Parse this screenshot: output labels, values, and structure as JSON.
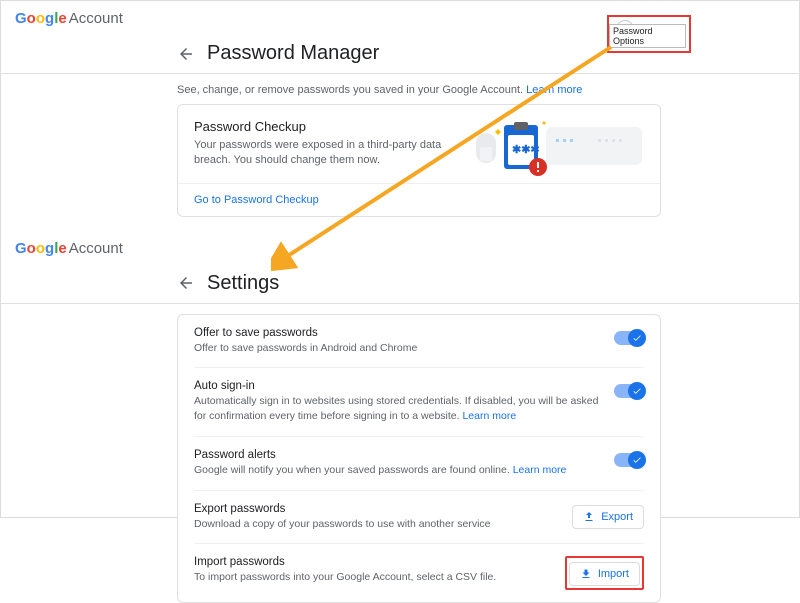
{
  "brand": {
    "g": "G",
    "o1": "o",
    "o2": "o",
    "g2": "g",
    "l": "l",
    "e": "e",
    "account_label": "Account"
  },
  "pm": {
    "title": "Password Manager",
    "subtext": "See, change, or remove passwords you saved in your Google Account.",
    "learn": "Learn more",
    "card_title": "Password Checkup",
    "card_desc": "Your passwords were exposed in a third-party data breach. You should change them now.",
    "card_link": "Go to Password Checkup"
  },
  "gear": {
    "tooltip": "Password Options"
  },
  "settings": {
    "title": "Settings",
    "rows": [
      {
        "title": "Offer to save passwords",
        "desc": "Offer to save passwords in Android and Chrome",
        "kind": "toggle"
      },
      {
        "title": "Auto sign-in",
        "desc": "Automatically sign in to websites using stored credentials. If disabled, you will be asked for confirmation every time before signing in to a website.",
        "learn": "Learn more",
        "kind": "toggle"
      },
      {
        "title": "Password alerts",
        "desc": "Google will notify you when your saved passwords are found online.",
        "learn": "Learn more",
        "kind": "toggle"
      },
      {
        "title": "Export passwords",
        "desc": "Download a copy of your passwords to use with another service",
        "kind": "button",
        "btn": "Export"
      },
      {
        "title": "Import passwords",
        "desc": "To import passwords into your Google Account, select a CSV file.",
        "kind": "button",
        "btn": "Import",
        "highlight": true
      }
    ]
  }
}
